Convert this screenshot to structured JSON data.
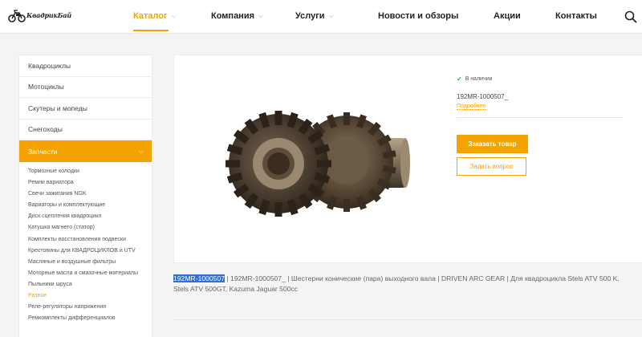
{
  "header": {
    "logo_text": "КвадрикБай",
    "nav": [
      {
        "label": "Каталог",
        "has_dropdown": true
      },
      {
        "label": "Компания",
        "has_dropdown": true
      },
      {
        "label": "Услуги",
        "has_dropdown": true
      },
      {
        "label": "Новости и обзоры",
        "has_dropdown": false
      },
      {
        "label": "Акции",
        "has_dropdown": false
      },
      {
        "label": "Контакты",
        "has_dropdown": false
      }
    ],
    "search_icon": "search-icon"
  },
  "sidebar": {
    "items": [
      {
        "label": "Квадроциклы"
      },
      {
        "label": "Мотоциклы"
      },
      {
        "label": "Скутеры и мопеды"
      },
      {
        "label": "Снегоходы"
      },
      {
        "label": "Запчасти"
      }
    ],
    "subitems": [
      {
        "label": "Тормозные колодки"
      },
      {
        "label": "Ремни вариатора"
      },
      {
        "label": "Свечи зажигания NGK"
      },
      {
        "label": "Вариаторы и комплектующие"
      },
      {
        "label": "Диск сцепления квадроцикл"
      },
      {
        "label": "Катушка магнето (статор)"
      },
      {
        "label": "Комплекты восстановления подвески"
      },
      {
        "label": "Крестовины для КВАДРОЦИКЛОВ и UTV"
      },
      {
        "label": "Масляные и воздушные фильтры"
      },
      {
        "label": "Моторные масла и смазочные материалы"
      },
      {
        "label": "Пыльники шруса"
      },
      {
        "label": "Разное"
      },
      {
        "label": "Реле-регуляторы напряжения"
      },
      {
        "label": "Ремкомплекты дифференциалов"
      }
    ]
  },
  "product": {
    "stock_status": "В наличии",
    "sku": "192MR-1000507_",
    "more_link": "Подробнее",
    "order_button": "Заказать товар",
    "ask_button": "Задать вопрос",
    "description_highlight": "192MR-1000507",
    "description_rest": " | 192MR-1000507_  | Шестерни конические (пара) выходного вала | DRIVEN ARC GEAR | Для квадроцикла Stels ATV 500 K, Stels ATV 500GT, Kazuma Jaguar 500cc"
  },
  "colors": {
    "accent": "#f5a300",
    "in_stock": "#3aa13a",
    "selection": "#2f6fd6"
  }
}
